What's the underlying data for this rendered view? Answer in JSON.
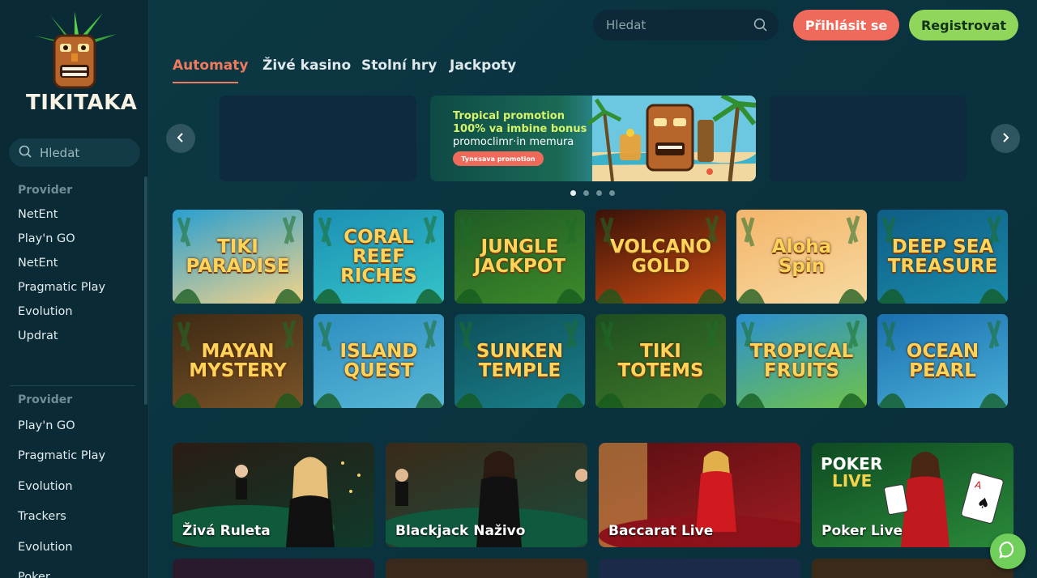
{
  "brand": {
    "name": "TIKITAKA"
  },
  "sidebar": {
    "search_placeholder": "Hledat",
    "section1": {
      "heading": "Provider",
      "items": [
        "NetEnt",
        "Play'n GO",
        "NetEnt",
        "Pragmatic Play",
        "Evolution",
        "Updrat"
      ]
    },
    "section2": {
      "heading": "Provider",
      "items": [
        "Play'n GO",
        "Pragmatic Play",
        "Evolution",
        "Trackers",
        "Evolution",
        "Poker"
      ]
    }
  },
  "header": {
    "search_placeholder": "Hledat",
    "login_label": "Přihlásit se",
    "register_label": "Registrovat"
  },
  "tabs": [
    {
      "label": "Automaty",
      "active": true
    },
    {
      "label": "Živé kasino",
      "active": false
    },
    {
      "label": "Stolní hry",
      "active": false
    },
    {
      "label": "Jackpoty",
      "active": false
    }
  ],
  "carousel": {
    "promo_line1": "Tropical promotion",
    "promo_line2": "100% va imbine bonus",
    "promo_line3": "promoclimr·in memura",
    "promo_button": "Tynкsava promotion",
    "active_dot": 0,
    "dot_count": 4
  },
  "games": [
    {
      "title": "TIKI\nPARADISE",
      "colors": [
        "#2a9fd0",
        "#f2d38a"
      ]
    },
    {
      "title": "CORAL REEF\nRICHES",
      "colors": [
        "#1c8fb4",
        "#34c3c8"
      ]
    },
    {
      "title": "JUNGLE\nJACKPOT",
      "colors": [
        "#1f5a25",
        "#3d8a2a"
      ]
    },
    {
      "title": "VOLCANO\nGOLD",
      "colors": [
        "#3a1208",
        "#c94a12"
      ]
    },
    {
      "title": "Aloha\nSpin",
      "colors": [
        "#f3b56a",
        "#f7d9a0"
      ]
    },
    {
      "title": "DEEP SEA\nTREASURE",
      "colors": [
        "#0f5e86",
        "#1a8aa9"
      ]
    },
    {
      "title": "MAYAN\nMYSTERY",
      "colors": [
        "#3e2a14",
        "#7a5428"
      ]
    },
    {
      "title": "ISLAND\nQUEST",
      "colors": [
        "#2d8ec0",
        "#58b7d6"
      ]
    },
    {
      "title": "SUNKEN\nTEMPLE",
      "colors": [
        "#0d4f5a",
        "#1a7f8a"
      ]
    },
    {
      "title": "TIKI\nTOTEMS",
      "colors": [
        "#1f4d1f",
        "#3f7a2a"
      ]
    },
    {
      "title": "TROPICAL\nFRUITS",
      "colors": [
        "#2b8fd0",
        "#6fc24a"
      ]
    },
    {
      "title": "OCEAN\nPEARL",
      "colors": [
        "#1a6fae",
        "#4ab0d8"
      ]
    }
  ],
  "live_games": [
    {
      "label": "Živá Ruleta",
      "colors": [
        "#2a1c14",
        "#0f3a2a"
      ]
    },
    {
      "label": "Blackjack Naživo",
      "colors": [
        "#3a2a1a",
        "#1c4a3a"
      ]
    },
    {
      "label": "Baccarat Live",
      "colors": [
        "#5a0f12",
        "#a01c22"
      ]
    },
    {
      "label": "Poker Live",
      "colors": [
        "#0f4a22",
        "#2a8a3a"
      ]
    }
  ],
  "poker_logo": {
    "line1": "POKER",
    "line2": "LIVE"
  }
}
